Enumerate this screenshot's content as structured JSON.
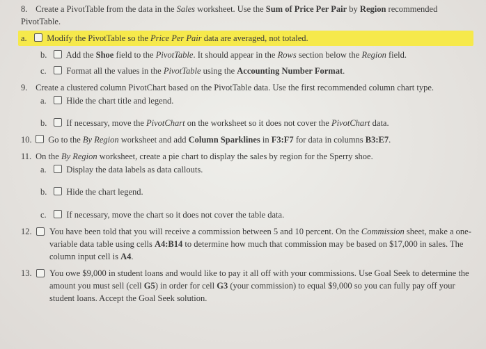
{
  "q8": {
    "num": "8.",
    "text_pre": "Create a PivotTable from the data in the ",
    "text_sales": "Sales",
    "text_mid1": " worksheet. Use the ",
    "text_sum": "Sum of Price Per Pair",
    "text_mid2": " by ",
    "text_region": "Region",
    "text_post": " recommended PivotTable.",
    "a": {
      "label": "a.",
      "t1": "Modify the PivotTable so the ",
      "t2": "Price Per Pair",
      "t3": " data are averaged, not totaled."
    },
    "b": {
      "label": "b.",
      "t1": "Add the ",
      "t2": "Shoe",
      "t3": " field to the ",
      "t4": "PivotTable",
      "t5": ". It should appear in the ",
      "t6": "Rows",
      "t7": " section below the ",
      "t8": "Region",
      "t9": " field."
    },
    "c": {
      "label": "c.",
      "t1": "Format all the values in the ",
      "t2": "PivotTable",
      "t3": " using the ",
      "t4": "Accounting Number Format",
      "t5": "."
    }
  },
  "q9": {
    "num": "9.",
    "text": "Create a clustered column PivotChart based on the PivotTable data. Use the first recommended column chart type.",
    "a": {
      "label": "a.",
      "t1": "Hide the chart title and legend."
    },
    "b": {
      "label": "b.",
      "t1": "If necessary, move the ",
      "t2": "PivotChart",
      "t3": " on the worksheet so it does not cover the ",
      "t4": "PivotChart",
      "t5": " data."
    }
  },
  "q10": {
    "num": "10.",
    "t1": "Go to the ",
    "t2": "By Region",
    "t3": " worksheet and add ",
    "t4": "Column Sparklines",
    "t5": " in ",
    "t6": "F3:F7",
    "t7": " for data in columns ",
    "t8": "B3:E7",
    "t9": "."
  },
  "q11": {
    "num": "11.",
    "t1": "On the ",
    "t2": "By Region",
    "t3": " worksheet, create a pie chart to display the sales by region for the Sperry shoe.",
    "a": {
      "label": "a.",
      "t1": "Display the data labels as data callouts."
    },
    "b": {
      "label": "b.",
      "t1": "Hide the chart legend."
    },
    "c": {
      "label": "c.",
      "t1": "If necessary, move the chart so it does not cover the table data."
    }
  },
  "q12": {
    "num": "12.",
    "t1": "You have been told that you will receive a commission between 5 and 10 percent. On the ",
    "t2": "Commission",
    "t3": " sheet, make a one-variable data table using cells ",
    "t4": "A4:B14",
    "t5": " to determine how much that commission may be based on $17,000 in sales. The column input cell is ",
    "t6": "A4",
    "t7": "."
  },
  "q13": {
    "num": "13.",
    "t1": "You owe $9,000 in student loans and would like to pay it all off with your commissions. Use Goal Seek to determine the amount you must sell (cell ",
    "t2": "G5",
    "t3": ") in order for cell ",
    "t4": "G3",
    "t5": " (your commission) to equal $9,000 so you can fully pay off your student loans. Accept the Goal Seek solution."
  }
}
